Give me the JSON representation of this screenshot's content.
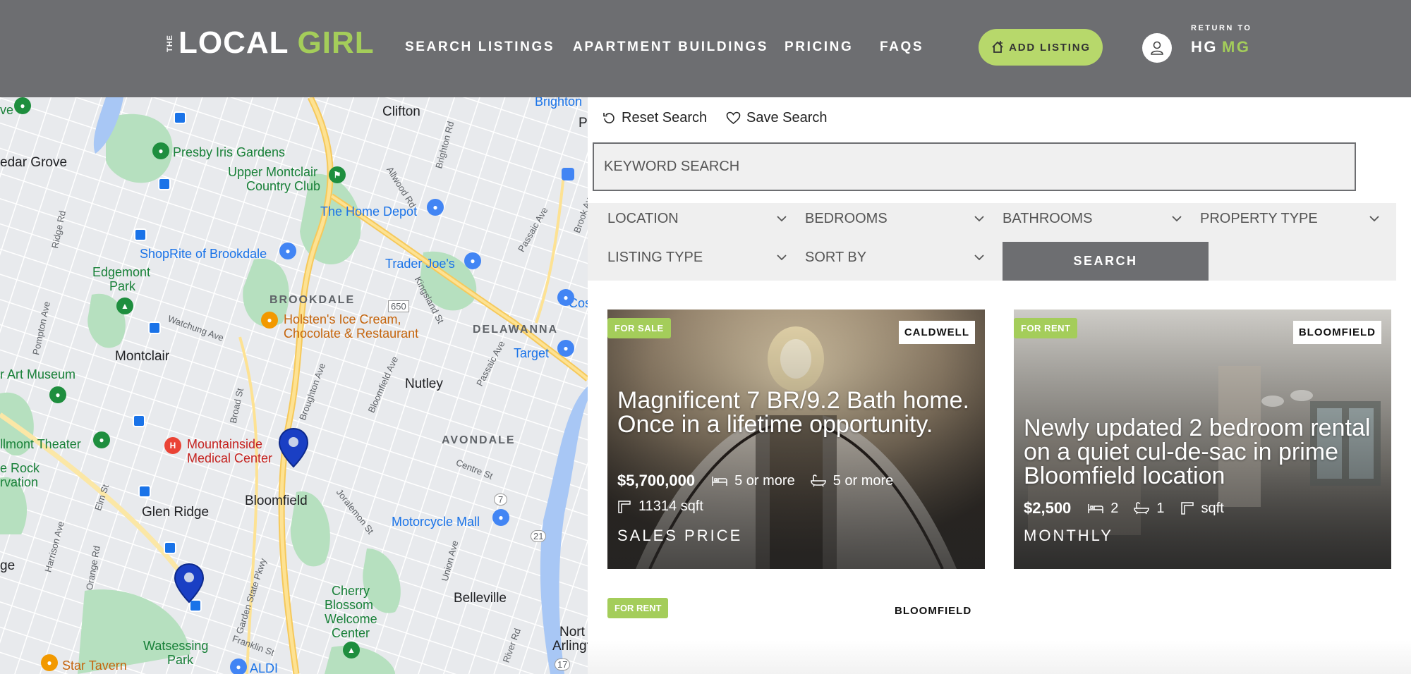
{
  "brand": {
    "the": "THE",
    "local": "LOCAL",
    "girl": "GIRL"
  },
  "nav": [
    {
      "label": "SEARCH LISTINGS"
    },
    {
      "label": "APARTMENT BUILDINGS"
    },
    {
      "label": "PRICING"
    },
    {
      "label": "FAQS"
    }
  ],
  "add_listing": "ADD LISTING",
  "return": {
    "label": "RETURN TO",
    "hg": "HG",
    "mg": "MG"
  },
  "map": {
    "places": {
      "clifton": "Clifton",
      "cedar_grove": "edar Grove",
      "presby": "Presby Iris Gardens",
      "upper_montclair": "Upper Montclair",
      "country_club": "Country Club",
      "home_depot": "The Home Depot",
      "shoprite": "ShopRite of Brookdale",
      "trader_joes": "Trader Joe's",
      "edgemont": "Edgemont",
      "park": "Park",
      "brookdale": "BROOKDALE",
      "holsten1": "Holsten's Ice Cream,",
      "holsten2": "Chocolate & Restaurant",
      "delawanna": "DELAWANNA",
      "target": "Target",
      "montclair": "Montclair",
      "art_museum": "r Art Museum",
      "nutley": "Nutley",
      "avondale": "AVONDALE",
      "mountainside1": "Mountainside",
      "mountainside2": "Medical Center",
      "llmont": "llmont Theater",
      "rock": "e Rock",
      "rvation": "rvation",
      "bloomfield": "Bloomfield",
      "glen_ridge": "Glen Ridge",
      "motorcycle_mall": "Motorcycle Mall",
      "ge": "ge",
      "belleville": "Belleville",
      "cherry1": "Cherry",
      "cherry2": "Blossom",
      "cherry3": "Welcome",
      "cherry4": "Center",
      "north1": "Nort",
      "north2": "Arlingt",
      "watsessing1": "Watsessing",
      "watsessing2": "Park",
      "star_tavern": "Star Tavern",
      "aldi": "ALDI",
      "brighton": "Brighton",
      "p": "P",
      "cos": "Cos",
      "ve": "ve"
    },
    "streets": {
      "allwood": "Allwood Rd",
      "brighton_rd": "Brighton Rd",
      "passaic_ave": "Passaic Ave",
      "brook_av": "Brook Av",
      "ridge_rd": "Ridge Rd",
      "kingsland": "Kingsland St",
      "route_650": "650",
      "pompton": "Pompton Ave",
      "watchung": "Watchung Ave",
      "bloomfield_ave": "Bloomfield Ave",
      "broughton": "Broughton Ave",
      "broad": "Broad St",
      "passaic_ave2": "Passaic Ave",
      "centre": "Centre St",
      "joralemon": "Joralemon St",
      "elm": "Elm St",
      "harrison": "Harrison Ave",
      "orange": "Orange Rd",
      "gsp": "Garden State Pkwy",
      "franklin": "Franklin St",
      "union": "Union Ave",
      "river": "River Rd",
      "route_7": "7",
      "route_21": "21",
      "route_17": "17"
    }
  },
  "search": {
    "reset": "Reset Search",
    "save": "Save Search",
    "keyword_placeholder": "KEYWORD SEARCH",
    "filters": [
      "LOCATION",
      "BEDROOMS",
      "BATHROOMS",
      "PROPERTY TYPE",
      "LISTING TYPE",
      "SORT BY"
    ],
    "search_button": "SEARCH"
  },
  "listings": [
    {
      "status": "FOR SALE",
      "town": "CALDWELL",
      "title": "Magnificent 7 BR/9.2 Bath home. Once in a lifetime opportunity.",
      "price": "$5,700,000",
      "beds": "5 or more",
      "baths": "5 or more",
      "sqft": "11314 sqft",
      "price_label": "SALES PRICE"
    },
    {
      "status": "FOR RENT",
      "town": "BLOOMFIELD",
      "title": "Newly updated 2 bedroom rental on a quiet cul-de-sac in prime Bloomfield location",
      "price": "$2,500",
      "beds": "2",
      "baths": "1",
      "sqft": "sqft",
      "price_label": "MONTHLY"
    },
    {
      "status": "FOR RENT",
      "town": "BLOOMFIELD"
    }
  ],
  "colors": {
    "header": "#6d6e71",
    "accent": "#a4cd5a",
    "button": "#b7d86b"
  }
}
